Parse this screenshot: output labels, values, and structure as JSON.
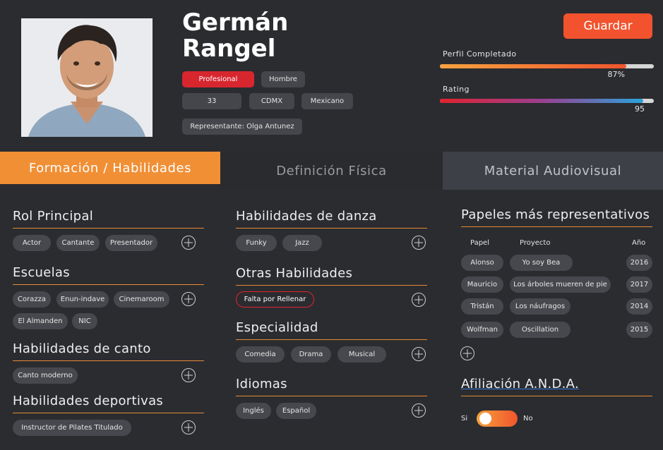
{
  "profile": {
    "first_name": "Germán",
    "last_name": "Rangel",
    "tags": [
      "Profesional",
      "Hombre",
      "33",
      "CDMX",
      "Mexicano",
      "Representante: Olga Antunez"
    ],
    "save_label": "Guardar",
    "profile_complete": {
      "label": "Perfil Completado",
      "value_text": "87%",
      "fraction": 0.87
    },
    "rating": {
      "label": "Rating",
      "value_text": "95",
      "fraction": 0.95
    }
  },
  "tabs": [
    "Formación / Habilidades",
    "Definición Física",
    "Material Audiovisual"
  ],
  "sections": {
    "rol_principal": {
      "title": "Rol Principal",
      "items": [
        "Actor",
        "Cantante",
        "Presentador"
      ]
    },
    "escuelas": {
      "title": "Escuelas",
      "items": [
        "Corazza",
        "Enun-indave",
        "Cinemaroom",
        "El Almanden",
        "NIC"
      ]
    },
    "canto": {
      "title": "Habilidades de canto",
      "items": [
        "Canto moderno"
      ]
    },
    "deportivas": {
      "title": "Habilidades deportivas",
      "items": [
        "Instructor de Pilates Titulado"
      ]
    },
    "danza": {
      "title": "Habilidades de danza",
      "items": [
        "Funky",
        "Jazz"
      ]
    },
    "otras": {
      "title": "Otras Habilidades",
      "items": [
        "Falta por Rellenar"
      ]
    },
    "especialidad": {
      "title": "Especialidad",
      "items": [
        "Comedia",
        "Drama",
        "Musical"
      ]
    },
    "idiomas": {
      "title": "Idiomas",
      "items": [
        "Inglés",
        "Español"
      ]
    },
    "papeles": {
      "title": "Papeles más representativos",
      "columns": [
        "Papel",
        "Proyecto",
        "Año"
      ],
      "rows": [
        {
          "papel": "Alonso",
          "proyecto": "Yo soy Bea",
          "anio": "2016"
        },
        {
          "papel": "Mauricio",
          "proyecto": "Los árboles mueren de pie",
          "anio": "2017"
        },
        {
          "papel": "Tristán",
          "proyecto": "Los náufragos",
          "anio": "2014"
        },
        {
          "papel": "Wolfman",
          "proyecto": "Oscillation",
          "anio": "2015"
        }
      ]
    },
    "anda": {
      "title": "Afiliación A.N.D.A.",
      "yes": "Si",
      "no": "No"
    }
  },
  "colors": {
    "accent": "#f18f35",
    "save": "#f2532e",
    "tag_red": "#d8262f",
    "background": "#2b2c30"
  }
}
